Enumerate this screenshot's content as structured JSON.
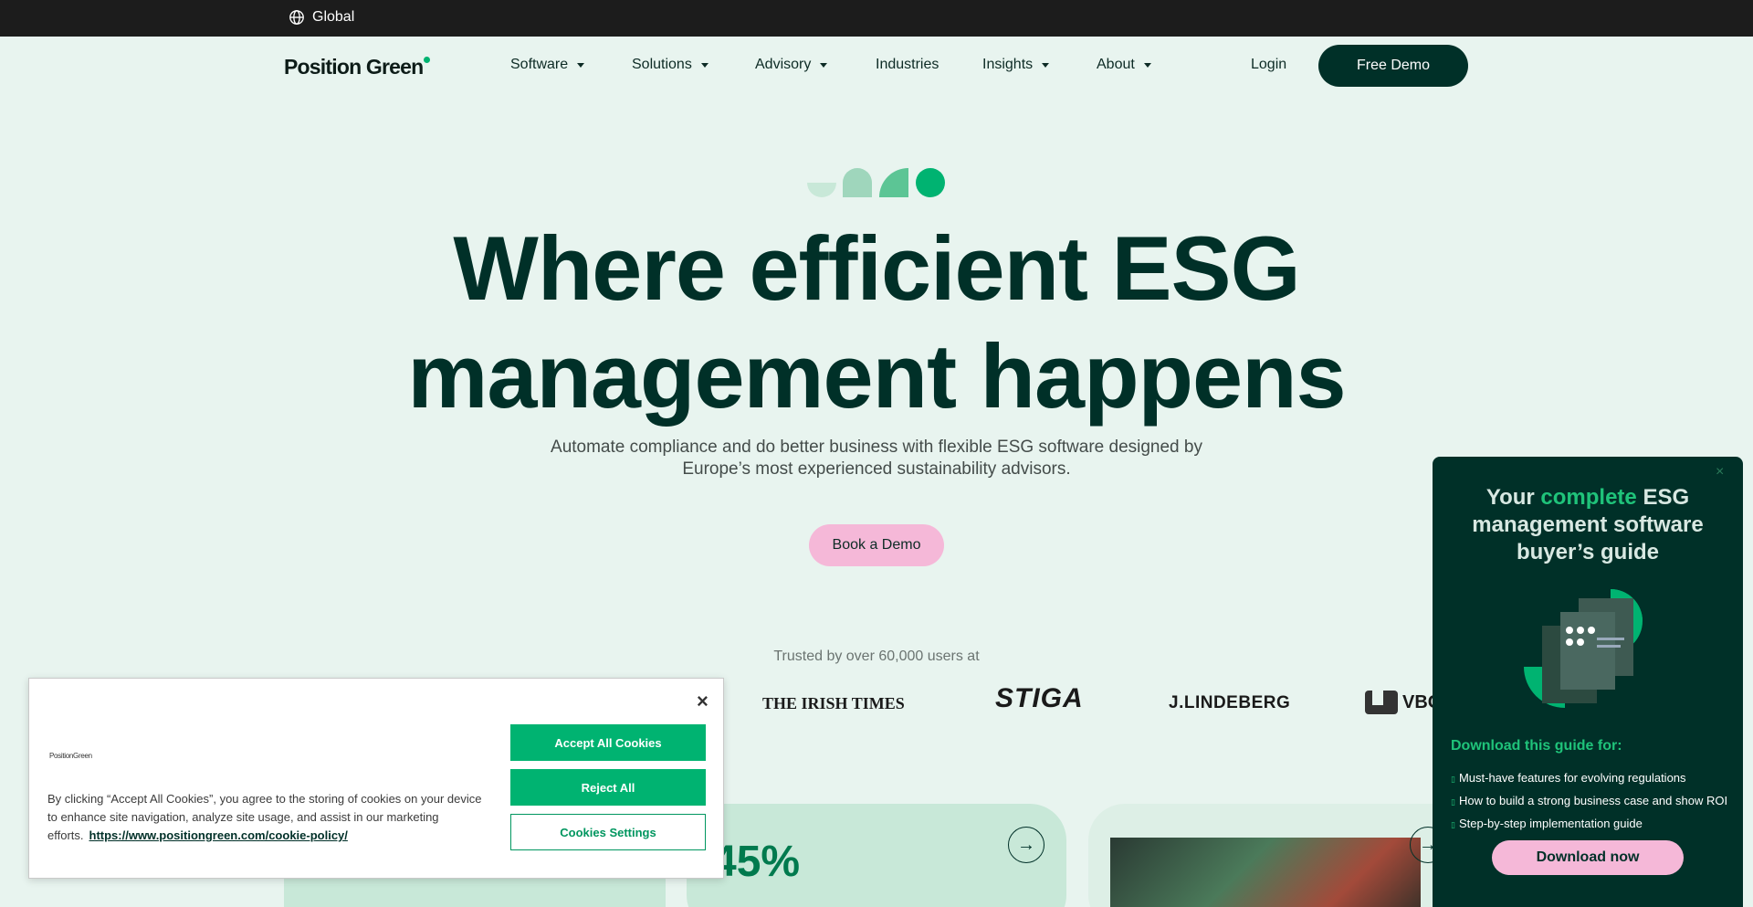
{
  "topbar": {
    "region_label": "Global",
    "icon": "globe-icon"
  },
  "nav": {
    "logo": "Position Green",
    "items": [
      {
        "label": "Software",
        "has_dropdown": true
      },
      {
        "label": "Solutions",
        "has_dropdown": true
      },
      {
        "label": "Advisory",
        "has_dropdown": true
      },
      {
        "label": "Industries",
        "has_dropdown": false
      },
      {
        "label": "Insights",
        "has_dropdown": true
      },
      {
        "label": "About",
        "has_dropdown": true
      }
    ],
    "login_label": "Login",
    "cta_label": "Free Demo"
  },
  "hero": {
    "title_line1": "Where efficient ESG",
    "title_line2": "management happens",
    "subtitle_line1": "Automate compliance and do better business with flexible ESG software designed by",
    "subtitle_line2": "Europe’s most experienced sustainability advisors.",
    "cta_label": "Book a Demo"
  },
  "trusted": {
    "label": "Trusted by over 60,000 users at",
    "brands": [
      "THE IRISH TIMES",
      "STIGA",
      "J.LINDEBERG",
      "VBG"
    ]
  },
  "cards": {
    "stat": "45%"
  },
  "cookie": {
    "logo": "PositionGreen",
    "text": "By clicking “Accept All Cookies”, you agree to the storing of cookies on your device to enhance site navigation, analyze site usage, and assist in our marketing efforts.",
    "link": "https://www.positiongreen.com/cookie-policy/",
    "accept_label": "Accept All Cookies",
    "reject_label": "Reject All",
    "settings_label": "Cookies Settings",
    "close_label": "×"
  },
  "popup": {
    "title_pre": "Your ",
    "title_highlight": "complete",
    "title_post": " ESG management software buyer’s guide",
    "list_title": "Download this guide for:",
    "items": [
      "Must-have features for evolving regulations",
      "How to build a strong business case and show ROI",
      "Step-by-step implementation guide"
    ],
    "cta_label": "Download now",
    "close_label": "×"
  },
  "colors": {
    "background": "#e8f4ef",
    "primary_dark": "#003028",
    "accent_green": "#00b371",
    "accent_pink": "#f5b8d8"
  }
}
